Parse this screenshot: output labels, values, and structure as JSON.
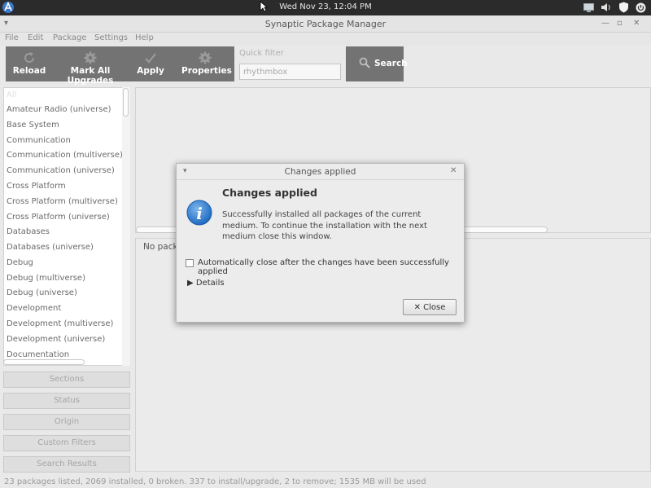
{
  "topbar": {
    "clock": "Wed Nov 23, 12:04 PM"
  },
  "window": {
    "title": "Synaptic Package Manager"
  },
  "menu": [
    "File",
    "Edit",
    "Package",
    "Settings",
    "Help"
  ],
  "toolbar": {
    "reload": "Reload",
    "mark_all": "Mark All Upgrades",
    "apply": "Apply",
    "properties": "Properties"
  },
  "quick_filter": {
    "label": "Quick filter",
    "value": "rhythmbox"
  },
  "search": {
    "label": "Search"
  },
  "categories": [
    "All",
    "Amateur Radio (universe)",
    "Base System",
    "Communication",
    "Communication (multiverse)",
    "Communication (universe)",
    "Cross Platform",
    "Cross Platform (multiverse)",
    "Cross Platform (universe)",
    "Databases",
    "Databases (universe)",
    "Debug",
    "Debug (multiverse)",
    "Debug (universe)",
    "Development",
    "Development (multiverse)",
    "Development (universe)",
    "Documentation"
  ],
  "sidebar_buttons": {
    "sections": "Sections",
    "status": "Status",
    "origin": "Origin",
    "custom_filters": "Custom Filters",
    "search_results": "Search Results"
  },
  "description": {
    "text": "No pack"
  },
  "statusbar": {
    "text": "23 packages listed, 2069 installed, 0 broken. 337 to install/upgrade, 2 to remove; 1535 MB will be used"
  },
  "dialog": {
    "title": "Changes applied",
    "heading": "Changes applied",
    "message": "Successfully installed all packages of the current medium. To continue the installation with the next medium close this window.",
    "checkbox_label": "Automatically close after the changes have been successfully applied",
    "details_label": "Details",
    "close_label": "Close"
  },
  "colors": {
    "toolbar_bg": "#737373",
    "info_blue": "#2f7fd0",
    "topbar_bg": "#2b2b2b"
  }
}
